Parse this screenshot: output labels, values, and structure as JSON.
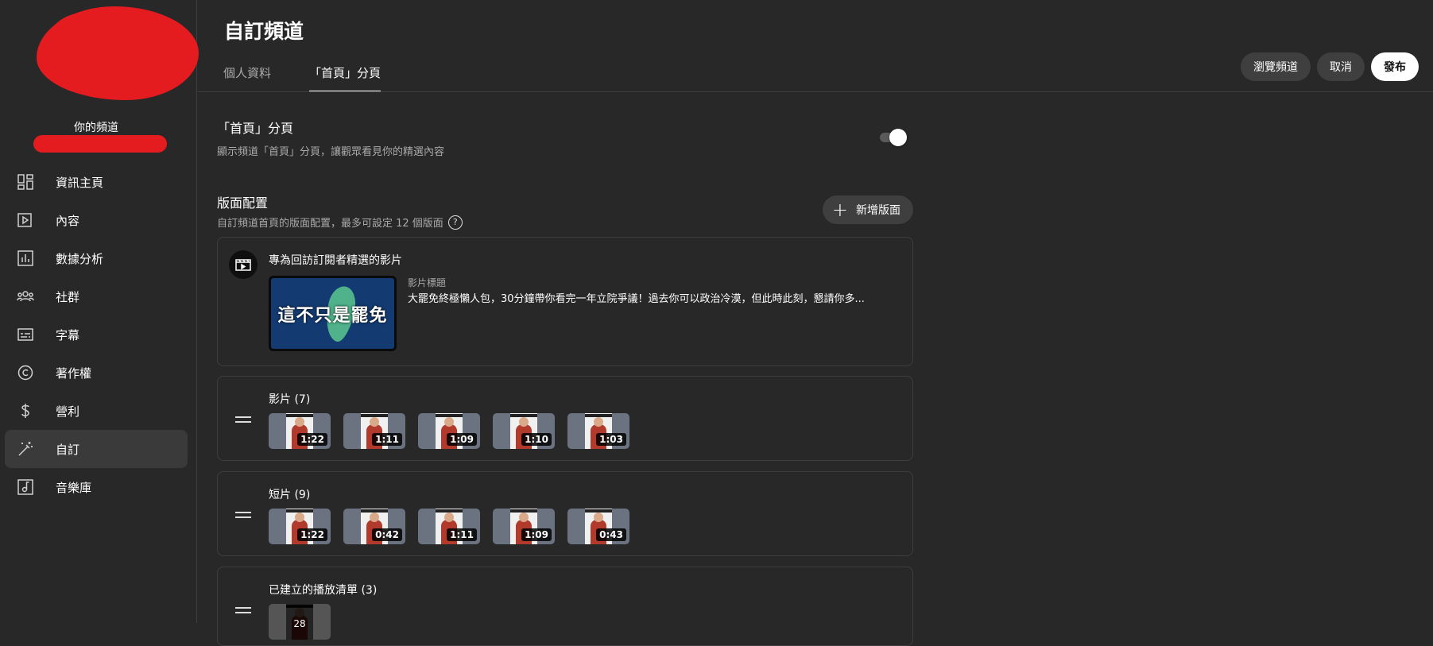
{
  "sidebar": {
    "channel_label": "你的頻道",
    "items": [
      {
        "label": "資訊主頁",
        "icon": "dashboard-icon"
      },
      {
        "label": "內容",
        "icon": "content-icon"
      },
      {
        "label": "數據分析",
        "icon": "analytics-icon"
      },
      {
        "label": "社群",
        "icon": "community-icon"
      },
      {
        "label": "字幕",
        "icon": "subtitles-icon"
      },
      {
        "label": "著作權",
        "icon": "copyright-icon"
      },
      {
        "label": "營利",
        "icon": "monetization-icon"
      },
      {
        "label": "自訂",
        "icon": "customization-icon",
        "active": true
      },
      {
        "label": "音樂庫",
        "icon": "audio-library-icon"
      }
    ]
  },
  "header": {
    "title": "自訂頻道",
    "tabs": [
      "個人資料",
      "「首頁」分頁"
    ],
    "active_tab": 1,
    "view_channel": "瀏覽頻道",
    "cancel": "取消",
    "publish": "發布"
  },
  "home_tab": {
    "title": "「首頁」分頁",
    "subtitle": "顯示頻道「首頁」分頁，讓觀眾看見你的精選內容",
    "toggle_on": true
  },
  "layout": {
    "title": "版面配置",
    "subtitle": "自訂頻道首頁的版面配置，最多可設定 12 個版面",
    "add_section": "新增版面"
  },
  "featured": {
    "title": "專為回訪訂閱者精選的影片",
    "thumb_text": "這不只是罷免",
    "meta_label": "影片標題",
    "meta_value": "大罷免終極懶人包，30分鐘帶你看完一年立院爭議！過去你可以政治冷漠，但此時此刻，懇請你多..."
  },
  "sections": [
    {
      "title": "影片 (7)",
      "durations": [
        "1:22",
        "1:11",
        "1:09",
        "1:10",
        "1:03"
      ]
    },
    {
      "title": "短片 (9)",
      "durations": [
        "1:22",
        "0:42",
        "1:11",
        "1:09",
        "0:43"
      ]
    },
    {
      "title": "已建立的播放清單 (3)",
      "playlist_count": "28"
    }
  ]
}
